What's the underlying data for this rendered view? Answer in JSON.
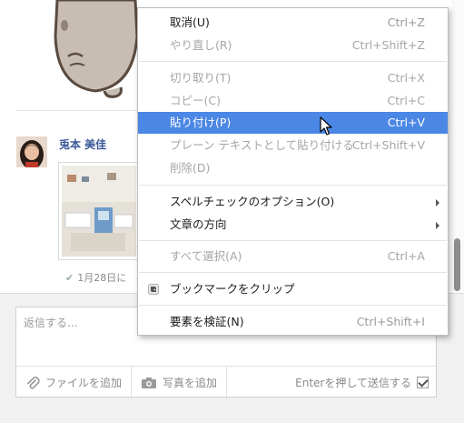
{
  "chat": {
    "author": "兎本 美佳",
    "seen_text": "1月28日に",
    "composer_placeholder": "返信する...",
    "tools": {
      "attach_file": "ファイルを追加",
      "add_photo": "写真を追加",
      "enter_to_send": "Enterを押して送信する"
    },
    "enter_to_send_checked": true
  },
  "context_menu": {
    "items": [
      {
        "label": "取消(U)",
        "shortcut": "Ctrl+Z",
        "enabled": true
      },
      {
        "label": "やり直し(R)",
        "shortcut": "Ctrl+Shift+Z",
        "enabled": false
      },
      {
        "label": "切り取り(T)",
        "shortcut": "Ctrl+X",
        "enabled": false
      },
      {
        "label": "コピー(C)",
        "shortcut": "Ctrl+C",
        "enabled": false
      },
      {
        "label": "貼り付け(P)",
        "shortcut": "Ctrl+V",
        "enabled": true,
        "highlighted": true
      },
      {
        "label": "プレーン テキストとして貼り付ける",
        "shortcut": "Ctrl+Shift+V",
        "enabled": false
      },
      {
        "label": "削除(D)",
        "shortcut": "",
        "enabled": false
      },
      {
        "label": "スペルチェックのオプション(O)",
        "shortcut": "",
        "enabled": true,
        "submenu": true
      },
      {
        "label": "文章の方向",
        "shortcut": "",
        "enabled": true,
        "submenu": true
      },
      {
        "label": "すべて選択(A)",
        "shortcut": "Ctrl+A",
        "enabled": false
      },
      {
        "label": "ブックマークをクリップ",
        "shortcut": "",
        "enabled": true,
        "icon": "evernote-icon"
      },
      {
        "label": "要素を検証(N)",
        "shortcut": "Ctrl+Shift+I",
        "enabled": true
      }
    ]
  },
  "colors": {
    "highlight": "#4b87e4",
    "author_link": "#3b5998",
    "disabled_text": "#a6a6a6"
  }
}
